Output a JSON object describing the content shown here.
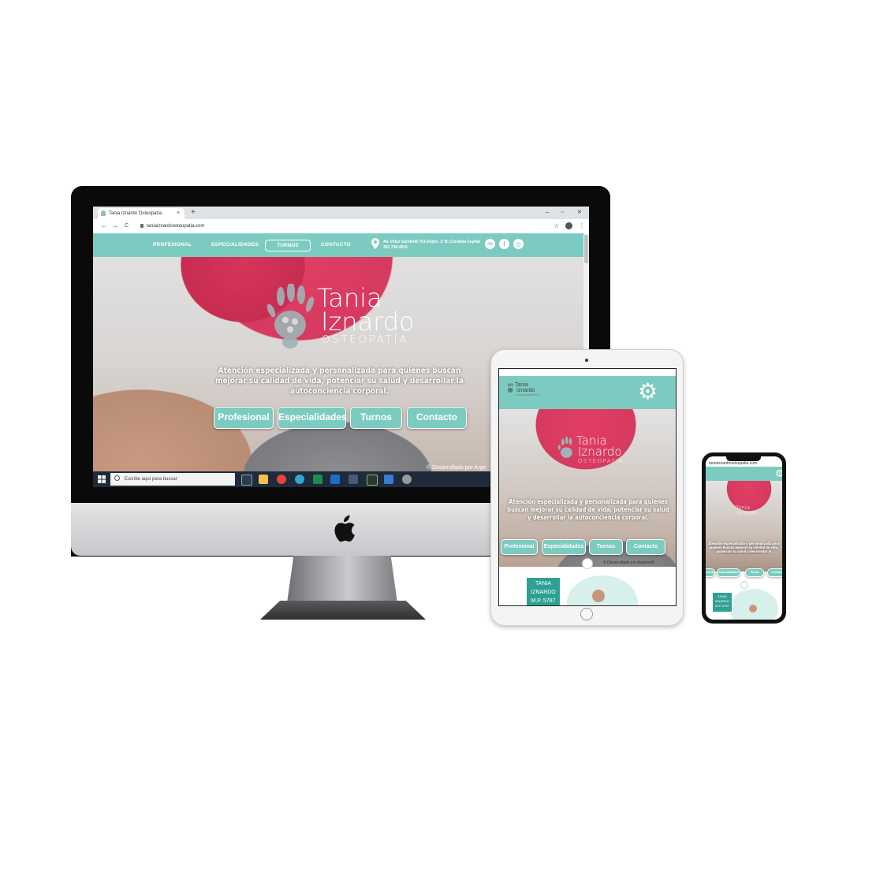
{
  "browser": {
    "tab_title": "Tania Iznardo Osteopatía",
    "url": "taniaiznardoosteopatia.com",
    "new_tab": "+",
    "tab_close": "×",
    "win_min": "–",
    "win_max": "▫",
    "win_close": "✕",
    "back": "←",
    "forward": "→",
    "reload": "C",
    "star": "☆",
    "menu": "⋮"
  },
  "site": {
    "nav": [
      "PROFESIONAL",
      "ESPECIALIDADES",
      "TURNOS",
      "CONTACTO"
    ],
    "address_line1": "Av. Vélez Sarsfield 761 Depto. 1º B, Córdoba Capital",
    "address_line2": "351 738-4916",
    "social": [
      "email-icon",
      "facebook-icon",
      "instagram-icon"
    ],
    "brand_first": "Tania",
    "brand_last": "Iznardo",
    "brand_sub": "OSTEOPATÍA",
    "tagline": "Atención especializada y personalizada para quienes buscan mejorar su calidad de vida, potenciar su salud y desarrollar la autoconciencia corporal.",
    "buttons": [
      "Profesional",
      "Especialidades",
      "Turnos",
      "Contacto"
    ],
    "credit": "© Desarrollado por Argensoft",
    "credit_short": "© Desarrollado por Arge",
    "profile": [
      "TANIA",
      "IZNARDO",
      "M.P. 5787"
    ]
  },
  "taskbar": {
    "search_placeholder": "Escribe aquí para buscar"
  },
  "phone": {
    "url": "taniaiznardoosteopatia.com"
  },
  "colors": {
    "accent": "#7ccbc0",
    "brand_pink": "#d63a5f"
  }
}
